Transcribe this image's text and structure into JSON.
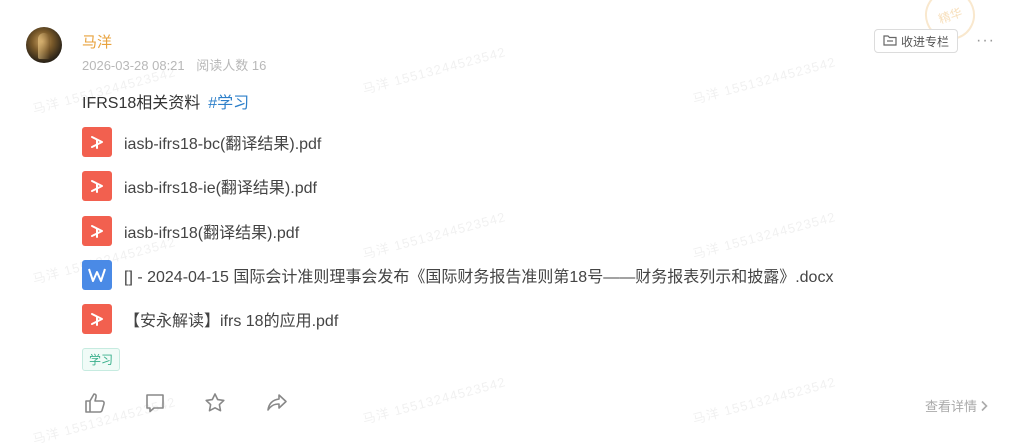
{
  "post": {
    "author": "马洋",
    "date": "2026-03-28 08:21",
    "read_count": "阅读人数 16",
    "title": "IFRS18相关资料",
    "topic_tag": "#学习",
    "collect_label": "收进专栏",
    "more_label": "···",
    "tag_chip": "学习",
    "details_label": "查看详情"
  },
  "attachments": [
    {
      "type": "pdf",
      "name": "iasb-ifrs18-bc(翻译结果).pdf"
    },
    {
      "type": "pdf",
      "name": "iasb-ifrs18-ie(翻译结果).pdf"
    },
    {
      "type": "pdf",
      "name": "iasb-ifrs18(翻译结果).pdf"
    },
    {
      "type": "doc",
      "name": "[] - 2024-04-15 国际会计准则理事会发布《国际财务报告准则第18号——财务报表列示和披露》.docx"
    },
    {
      "type": "pdf",
      "name": "【安永解读】ifrs 18的应用.pdf"
    }
  ],
  "watermark": "马洋 15513244523542",
  "stamp": "精华",
  "icons": {
    "like": "thumb-up-icon",
    "comment": "comment-icon",
    "favorite": "star-icon",
    "share": "share-icon",
    "collect": "folder-icon",
    "pdf": "pdf-icon",
    "doc": "word-doc-icon"
  },
  "colors": {
    "author": "#e8a23c",
    "topic": "#2d7fc9",
    "pdf": "#f2604f",
    "doc": "#4a8ae6",
    "chip": "#3ab08c"
  }
}
